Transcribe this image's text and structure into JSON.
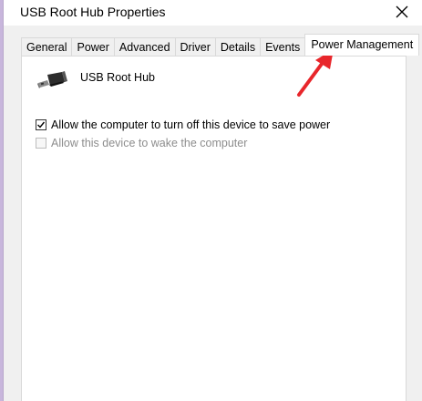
{
  "window": {
    "title": "USB Root Hub Properties"
  },
  "tabs": [
    {
      "label": "General",
      "active": false
    },
    {
      "label": "Power",
      "active": false
    },
    {
      "label": "Advanced",
      "active": false
    },
    {
      "label": "Driver",
      "active": false
    },
    {
      "label": "Details",
      "active": false
    },
    {
      "label": "Events",
      "active": false
    },
    {
      "label": "Power Management",
      "active": true
    }
  ],
  "device": {
    "icon": "usb-plug-icon",
    "name": "USB Root Hub"
  },
  "options": [
    {
      "label": "Allow the computer to turn off this device to save power",
      "checked": true,
      "enabled": true
    },
    {
      "label": "Allow this device to wake the computer",
      "checked": false,
      "enabled": false
    }
  ],
  "annotation": {
    "icon": "red-arrow-icon",
    "color": "#e8262b"
  },
  "colors": {
    "background_outside": "#c8b6dc",
    "dialog_bg": "#f0f0f0",
    "panel_bg": "#ffffff",
    "disabled_text": "#8d8d8d"
  }
}
